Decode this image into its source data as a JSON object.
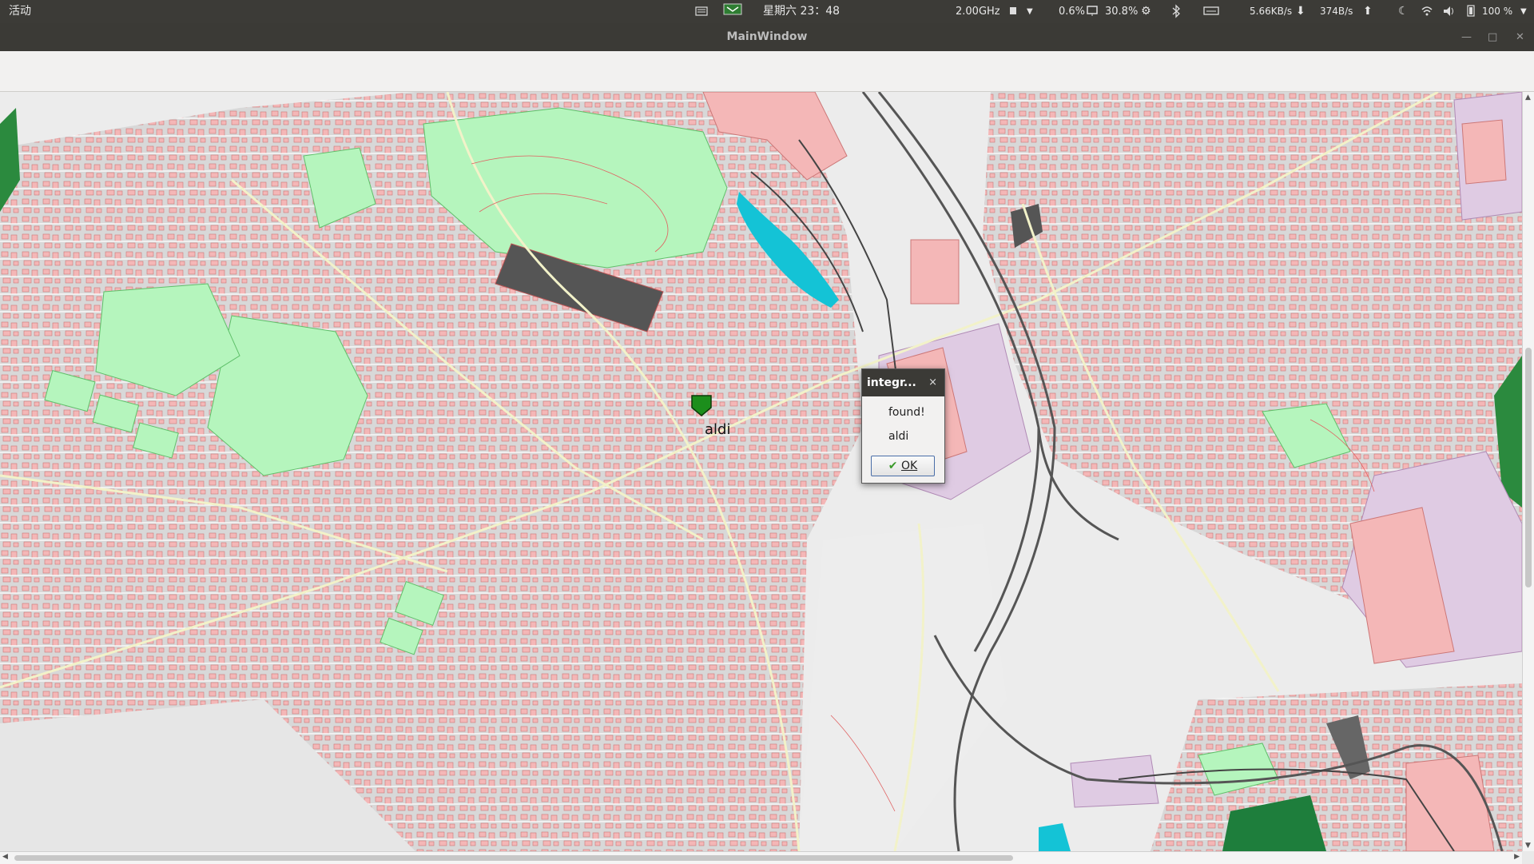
{
  "topbar": {
    "activities": "活动",
    "datetime": "星期六 23：48",
    "cpu_freq": "2.00GHz",
    "cpu_usage": "0.6%",
    "mem_usage": "30.8%",
    "net_down": "5.66KB/s",
    "net_up": "374B/s",
    "battery": "100 %"
  },
  "window": {
    "title": "MainWindow"
  },
  "map": {
    "marker_label": "aldi"
  },
  "dialog": {
    "title": "integr...",
    "close": "×",
    "message1": "found!",
    "message2": "aldi",
    "ok_label": "OK"
  },
  "colors": {
    "building": "#f4b7b7",
    "park": "#b5f5bd",
    "water": "#14c3d6",
    "industrial": "#dfcbe3",
    "marker": "#1c8e1c"
  }
}
